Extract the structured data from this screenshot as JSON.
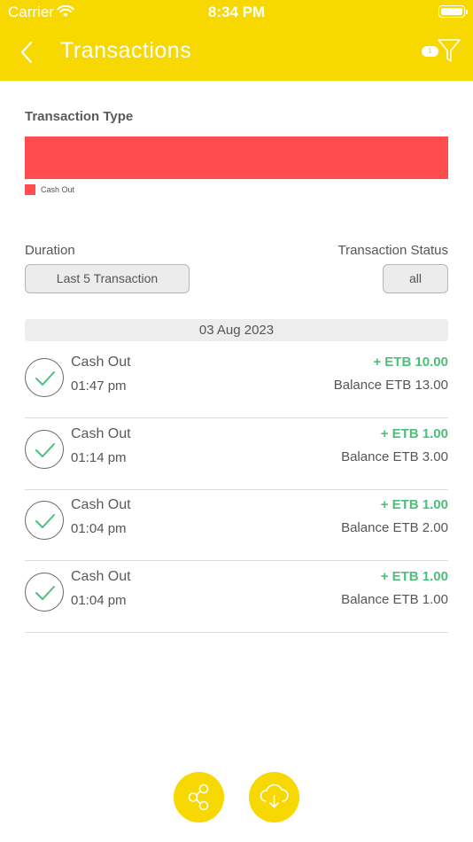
{
  "status_bar": {
    "carrier": "Carrier",
    "time": "8:34 PM"
  },
  "header": {
    "title": "Transactions",
    "filter_badge": "1"
  },
  "type_chart": {
    "title": "Transaction Type",
    "legend_label": "Cash Out",
    "color": "#ff4d4f"
  },
  "filters": {
    "duration_label": "Duration",
    "duration_value": "Last 5 Transaction",
    "status_label": "Transaction Status",
    "status_value": "all"
  },
  "date_group": "03 Aug 2023",
  "transactions": [
    {
      "type": "Cash Out",
      "time": "01:47 pm",
      "amount": "+ ETB 10.00",
      "balance": "Balance ETB 13.00"
    },
    {
      "type": "Cash Out",
      "time": "01:14 pm",
      "amount": "+ ETB 1.00",
      "balance": "Balance ETB 3.00"
    },
    {
      "type": "Cash Out",
      "time": "01:04 pm",
      "amount": "+ ETB 1.00",
      "balance": "Balance ETB 2.00"
    },
    {
      "type": "Cash Out",
      "time": "01:04 pm",
      "amount": "+ ETB 1.00",
      "balance": "Balance ETB 1.00"
    }
  ],
  "actions": {
    "share_icon": "share-icon",
    "download_icon": "cloud-download-icon"
  },
  "colors": {
    "accent": "#f7d800",
    "amount": "#4cbf79",
    "cash_out": "#ff4d4f"
  }
}
